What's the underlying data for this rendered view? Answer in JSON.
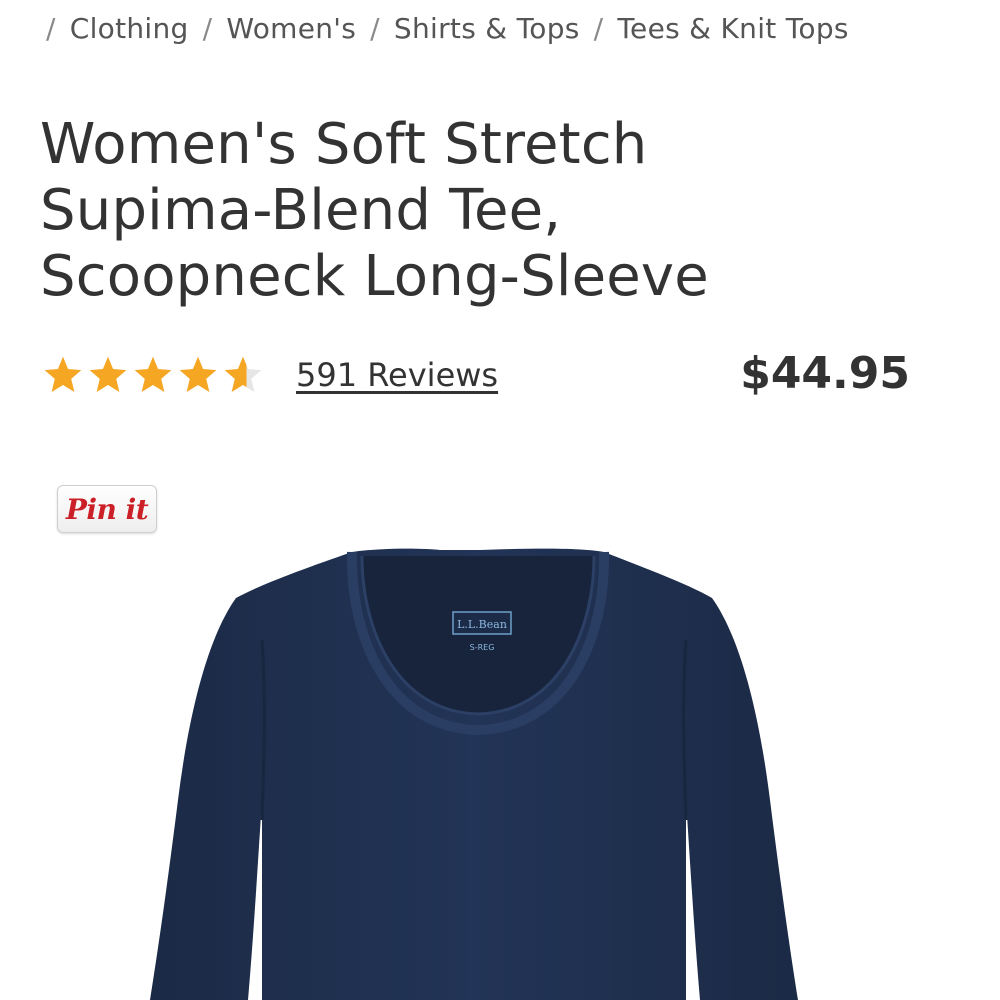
{
  "breadcrumb": {
    "separator": "/",
    "items": [
      {
        "label": "Clothing"
      },
      {
        "label": "Women's"
      },
      {
        "label": "Shirts & Tops"
      },
      {
        "label": "Tees & Knit Tops"
      }
    ]
  },
  "product": {
    "title_lines": [
      "Women's Soft Stretch",
      "Supima-Blend Tee,",
      "Scoopneck Long-Sleeve"
    ],
    "rating": 4.6,
    "rating_max": 5,
    "reviews_label": "591 Reviews",
    "price": "$44.95",
    "garment_color": "#1f2f4c"
  },
  "pin_button": {
    "label": "Pin it",
    "color": "#cb2027"
  },
  "garment_label": {
    "brand": "L.L.Bean",
    "size": "S-REG"
  },
  "colors": {
    "star": "#f5a623",
    "star_empty": "#e6e6e6",
    "text": "#333333"
  },
  "icons": {
    "star": "star-icon"
  }
}
